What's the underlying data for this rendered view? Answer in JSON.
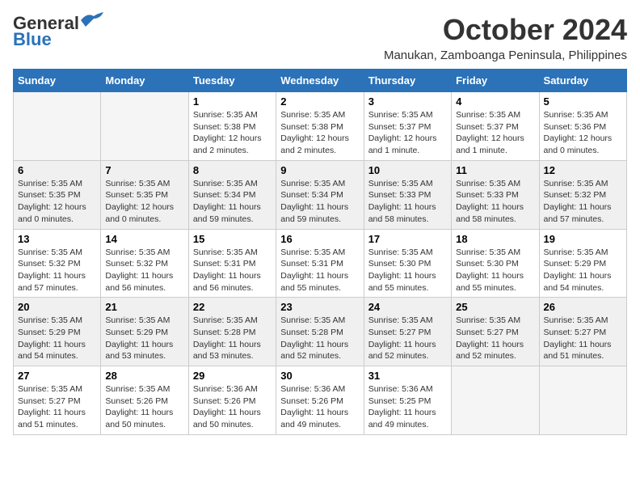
{
  "logo": {
    "general": "General",
    "blue": "Blue"
  },
  "title": "October 2024",
  "subtitle": "Manukan, Zamboanga Peninsula, Philippines",
  "headers": [
    "Sunday",
    "Monday",
    "Tuesday",
    "Wednesday",
    "Thursday",
    "Friday",
    "Saturday"
  ],
  "weeks": [
    [
      {
        "day": "",
        "detail": ""
      },
      {
        "day": "",
        "detail": ""
      },
      {
        "day": "1",
        "detail": "Sunrise: 5:35 AM\nSunset: 5:38 PM\nDaylight: 12 hours\nand 2 minutes."
      },
      {
        "day": "2",
        "detail": "Sunrise: 5:35 AM\nSunset: 5:38 PM\nDaylight: 12 hours\nand 2 minutes."
      },
      {
        "day": "3",
        "detail": "Sunrise: 5:35 AM\nSunset: 5:37 PM\nDaylight: 12 hours\nand 1 minute."
      },
      {
        "day": "4",
        "detail": "Sunrise: 5:35 AM\nSunset: 5:37 PM\nDaylight: 12 hours\nand 1 minute."
      },
      {
        "day": "5",
        "detail": "Sunrise: 5:35 AM\nSunset: 5:36 PM\nDaylight: 12 hours\nand 0 minutes."
      }
    ],
    [
      {
        "day": "6",
        "detail": "Sunrise: 5:35 AM\nSunset: 5:35 PM\nDaylight: 12 hours\nand 0 minutes."
      },
      {
        "day": "7",
        "detail": "Sunrise: 5:35 AM\nSunset: 5:35 PM\nDaylight: 12 hours\nand 0 minutes."
      },
      {
        "day": "8",
        "detail": "Sunrise: 5:35 AM\nSunset: 5:34 PM\nDaylight: 11 hours\nand 59 minutes."
      },
      {
        "day": "9",
        "detail": "Sunrise: 5:35 AM\nSunset: 5:34 PM\nDaylight: 11 hours\nand 59 minutes."
      },
      {
        "day": "10",
        "detail": "Sunrise: 5:35 AM\nSunset: 5:33 PM\nDaylight: 11 hours\nand 58 minutes."
      },
      {
        "day": "11",
        "detail": "Sunrise: 5:35 AM\nSunset: 5:33 PM\nDaylight: 11 hours\nand 58 minutes."
      },
      {
        "day": "12",
        "detail": "Sunrise: 5:35 AM\nSunset: 5:32 PM\nDaylight: 11 hours\nand 57 minutes."
      }
    ],
    [
      {
        "day": "13",
        "detail": "Sunrise: 5:35 AM\nSunset: 5:32 PM\nDaylight: 11 hours\nand 57 minutes."
      },
      {
        "day": "14",
        "detail": "Sunrise: 5:35 AM\nSunset: 5:32 PM\nDaylight: 11 hours\nand 56 minutes."
      },
      {
        "day": "15",
        "detail": "Sunrise: 5:35 AM\nSunset: 5:31 PM\nDaylight: 11 hours\nand 56 minutes."
      },
      {
        "day": "16",
        "detail": "Sunrise: 5:35 AM\nSunset: 5:31 PM\nDaylight: 11 hours\nand 55 minutes."
      },
      {
        "day": "17",
        "detail": "Sunrise: 5:35 AM\nSunset: 5:30 PM\nDaylight: 11 hours\nand 55 minutes."
      },
      {
        "day": "18",
        "detail": "Sunrise: 5:35 AM\nSunset: 5:30 PM\nDaylight: 11 hours\nand 55 minutes."
      },
      {
        "day": "19",
        "detail": "Sunrise: 5:35 AM\nSunset: 5:29 PM\nDaylight: 11 hours\nand 54 minutes."
      }
    ],
    [
      {
        "day": "20",
        "detail": "Sunrise: 5:35 AM\nSunset: 5:29 PM\nDaylight: 11 hours\nand 54 minutes."
      },
      {
        "day": "21",
        "detail": "Sunrise: 5:35 AM\nSunset: 5:29 PM\nDaylight: 11 hours\nand 53 minutes."
      },
      {
        "day": "22",
        "detail": "Sunrise: 5:35 AM\nSunset: 5:28 PM\nDaylight: 11 hours\nand 53 minutes."
      },
      {
        "day": "23",
        "detail": "Sunrise: 5:35 AM\nSunset: 5:28 PM\nDaylight: 11 hours\nand 52 minutes."
      },
      {
        "day": "24",
        "detail": "Sunrise: 5:35 AM\nSunset: 5:27 PM\nDaylight: 11 hours\nand 52 minutes."
      },
      {
        "day": "25",
        "detail": "Sunrise: 5:35 AM\nSunset: 5:27 PM\nDaylight: 11 hours\nand 52 minutes."
      },
      {
        "day": "26",
        "detail": "Sunrise: 5:35 AM\nSunset: 5:27 PM\nDaylight: 11 hours\nand 51 minutes."
      }
    ],
    [
      {
        "day": "27",
        "detail": "Sunrise: 5:35 AM\nSunset: 5:27 PM\nDaylight: 11 hours\nand 51 minutes."
      },
      {
        "day": "28",
        "detail": "Sunrise: 5:35 AM\nSunset: 5:26 PM\nDaylight: 11 hours\nand 50 minutes."
      },
      {
        "day": "29",
        "detail": "Sunrise: 5:36 AM\nSunset: 5:26 PM\nDaylight: 11 hours\nand 50 minutes."
      },
      {
        "day": "30",
        "detail": "Sunrise: 5:36 AM\nSunset: 5:26 PM\nDaylight: 11 hours\nand 49 minutes."
      },
      {
        "day": "31",
        "detail": "Sunrise: 5:36 AM\nSunset: 5:25 PM\nDaylight: 11 hours\nand 49 minutes."
      },
      {
        "day": "",
        "detail": ""
      },
      {
        "day": "",
        "detail": ""
      }
    ]
  ]
}
